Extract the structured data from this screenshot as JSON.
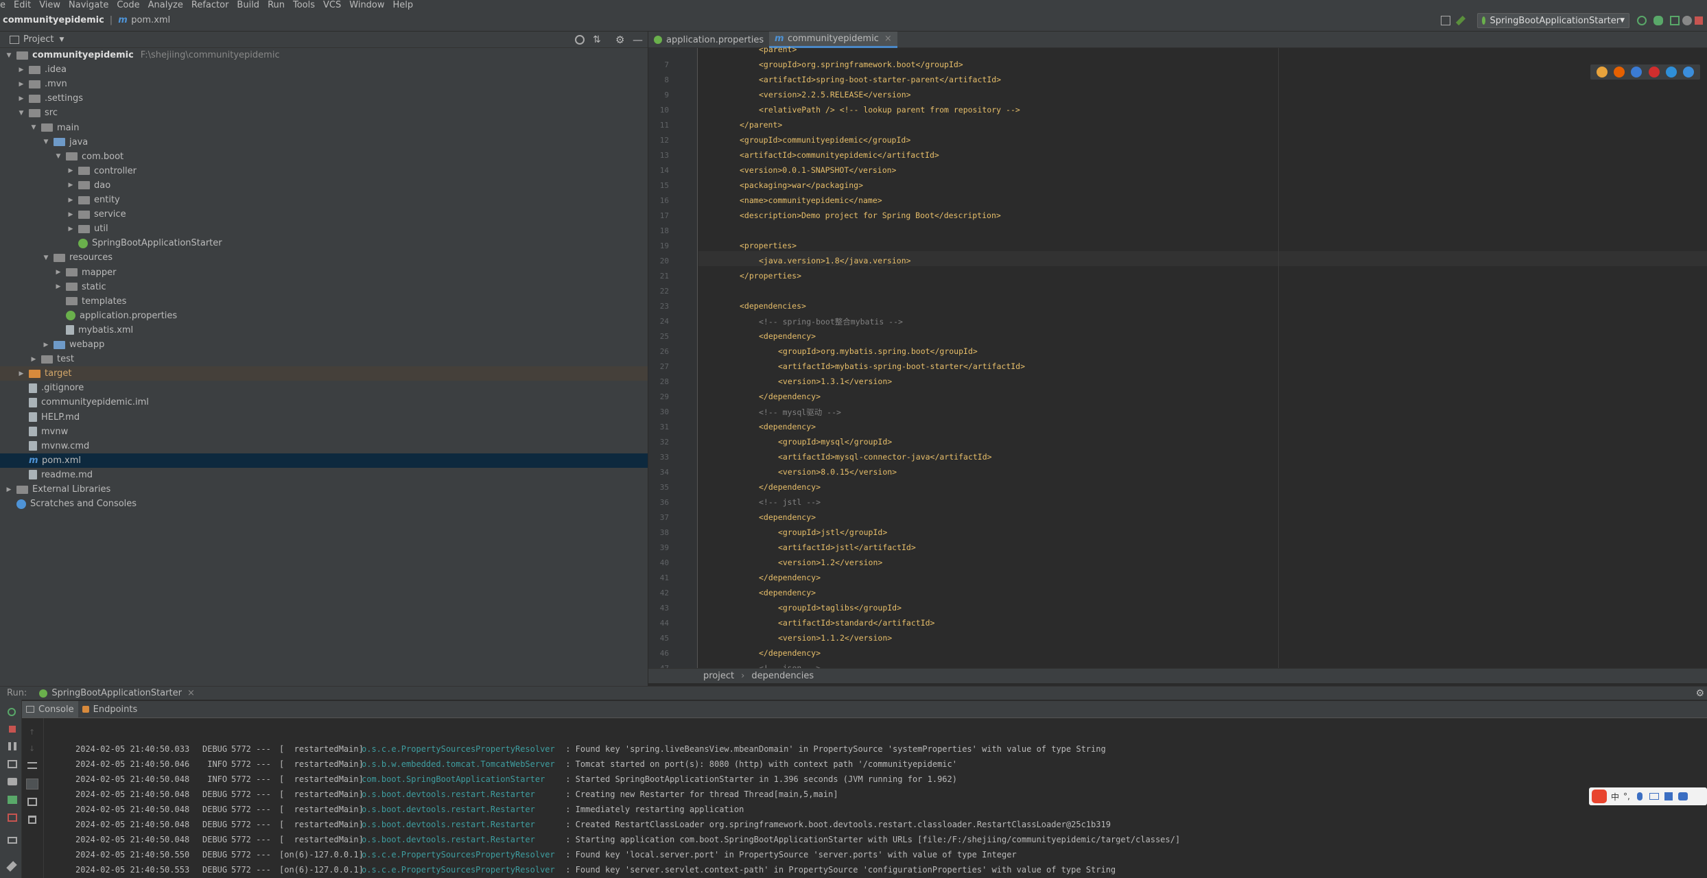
{
  "menu": [
    "e",
    "Edit",
    "View",
    "Navigate",
    "Code",
    "Analyze",
    "Refactor",
    "Build",
    "Run",
    "Tools",
    "VCS",
    "Window",
    "Help"
  ],
  "nav": {
    "project": "communityepidemic",
    "file": "pom.xml",
    "run_config": "SpringBootApplicationStarter"
  },
  "project_panel": {
    "title": "Project",
    "tree": [
      {
        "label": "communityepidemic",
        "path": "F:\\shejiing\\communityepidemic",
        "depth": 0,
        "icon": "folder-grey",
        "arrow": "▼",
        "bold": true
      },
      {
        "label": ".idea",
        "depth": 1,
        "icon": "folder-grey",
        "arrow": "▶"
      },
      {
        "label": ".mvn",
        "depth": 1,
        "icon": "folder-grey",
        "arrow": "▶"
      },
      {
        "label": ".settings",
        "depth": 1,
        "icon": "folder-grey",
        "arrow": "▶"
      },
      {
        "label": "src",
        "depth": 1,
        "icon": "folder-grey",
        "arrow": "▼"
      },
      {
        "label": "main",
        "depth": 2,
        "icon": "folder-grey",
        "arrow": "▼"
      },
      {
        "label": "java",
        "depth": 3,
        "icon": "folder-blue",
        "arrow": "▼"
      },
      {
        "label": "com.boot",
        "depth": 4,
        "icon": "folder-grey",
        "arrow": "▼"
      },
      {
        "label": "controller",
        "depth": 5,
        "icon": "folder-grey",
        "arrow": "▶"
      },
      {
        "label": "dao",
        "depth": 5,
        "icon": "folder-grey",
        "arrow": "▶"
      },
      {
        "label": "entity",
        "depth": 5,
        "icon": "folder-grey",
        "arrow": "▶"
      },
      {
        "label": "service",
        "depth": 5,
        "icon": "folder-grey",
        "arrow": "▶"
      },
      {
        "label": "util",
        "depth": 5,
        "icon": "folder-grey",
        "arrow": "▶"
      },
      {
        "label": "SpringBootApplicationStarter",
        "depth": 5,
        "icon": "spring",
        "arrow": ""
      },
      {
        "label": "resources",
        "depth": 3,
        "icon": "folder-grey",
        "arrow": "▼"
      },
      {
        "label": "mapper",
        "depth": 4,
        "icon": "folder-grey",
        "arrow": "▶"
      },
      {
        "label": "static",
        "depth": 4,
        "icon": "folder-grey",
        "arrow": "▶"
      },
      {
        "label": "templates",
        "depth": 4,
        "icon": "folder-grey",
        "arrow": ""
      },
      {
        "label": "application.properties",
        "depth": 4,
        "icon": "spring",
        "arrow": ""
      },
      {
        "label": "mybatis.xml",
        "depth": 4,
        "icon": "file",
        "arrow": ""
      },
      {
        "label": "webapp",
        "depth": 3,
        "icon": "folder-blue",
        "arrow": "▶"
      },
      {
        "label": "test",
        "depth": 2,
        "icon": "folder-grey",
        "arrow": "▶"
      },
      {
        "label": "target",
        "depth": 1,
        "icon": "folder-orange",
        "arrow": "▶",
        "state": "target"
      },
      {
        "label": ".gitignore",
        "depth": 1,
        "icon": "file",
        "arrow": ""
      },
      {
        "label": "communityepidemic.iml",
        "depth": 1,
        "icon": "file",
        "arrow": ""
      },
      {
        "label": "HELP.md",
        "depth": 1,
        "icon": "file",
        "arrow": ""
      },
      {
        "label": "mvnw",
        "depth": 1,
        "icon": "file",
        "arrow": ""
      },
      {
        "label": "mvnw.cmd",
        "depth": 1,
        "icon": "file",
        "arrow": ""
      },
      {
        "label": "pom.xml",
        "depth": 1,
        "icon": "maven",
        "arrow": "",
        "state": "selected"
      },
      {
        "label": "readme.md",
        "depth": 1,
        "icon": "file",
        "arrow": ""
      },
      {
        "label": "External Libraries",
        "depth": 0,
        "icon": "library",
        "arrow": "▶"
      },
      {
        "label": "Scratches and Consoles",
        "depth": 0,
        "icon": "scratch",
        "arrow": ""
      }
    ]
  },
  "editor": {
    "tabs": [
      "application.properties",
      "communityepidemic"
    ],
    "lines": [
      {
        "n": "",
        "indent": 2,
        "text": "<parent>"
      },
      {
        "n": "7",
        "indent": 2,
        "text": "<groupId>org.springframework.boot</groupId>"
      },
      {
        "n": "8",
        "indent": 2,
        "text": "<artifactId>spring-boot-starter-parent</artifactId>"
      },
      {
        "n": "9",
        "indent": 2,
        "text": "<version>2.2.5.RELEASE</version>"
      },
      {
        "n": "10",
        "indent": 2,
        "text": "<relativePath /> <!-- lookup parent from repository -->"
      },
      {
        "n": "11",
        "indent": 1,
        "text": "</parent>"
      },
      {
        "n": "12",
        "indent": 1,
        "text": "<groupId>communityepidemic</groupId>"
      },
      {
        "n": "13",
        "indent": 1,
        "text": "<artifactId>communityepidemic</artifactId>"
      },
      {
        "n": "14",
        "indent": 1,
        "text": "<version>0.0.1-SNAPSHOT</version>"
      },
      {
        "n": "15",
        "indent": 1,
        "text": "<packaging>war</packaging>"
      },
      {
        "n": "16",
        "indent": 1,
        "text": "<name>communityepidemic</name>"
      },
      {
        "n": "17",
        "indent": 1,
        "text": "<description>Demo project for Spring Boot</description>"
      },
      {
        "n": "18",
        "indent": 1,
        "text": ""
      },
      {
        "n": "19",
        "indent": 1,
        "text": "<properties>"
      },
      {
        "n": "20",
        "indent": 2,
        "text": "<java.version>1.8</java.version>"
      },
      {
        "n": "21",
        "indent": 1,
        "text": "</properties>"
      },
      {
        "n": "22",
        "indent": 1,
        "text": ""
      },
      {
        "n": "23",
        "indent": 1,
        "text": "<dependencies>"
      },
      {
        "n": "24",
        "indent": 2,
        "text": "<!-- spring-boot整合mybatis -->"
      },
      {
        "n": "25",
        "indent": 2,
        "text": "<dependency>"
      },
      {
        "n": "26",
        "indent": 3,
        "text": "<groupId>org.mybatis.spring.boot</groupId>"
      },
      {
        "n": "27",
        "indent": 3,
        "text": "<artifactId>mybatis-spring-boot-starter</artifactId>"
      },
      {
        "n": "28",
        "indent": 3,
        "text": "<version>1.3.1</version>"
      },
      {
        "n": "29",
        "indent": 2,
        "text": "</dependency>"
      },
      {
        "n": "30",
        "indent": 2,
        "text": "<!-- mysql驱动 -->"
      },
      {
        "n": "31",
        "indent": 2,
        "text": "<dependency>"
      },
      {
        "n": "32",
        "indent": 3,
        "text": "<groupId>mysql</groupId>"
      },
      {
        "n": "33",
        "indent": 3,
        "text": "<artifactId>mysql-connector-java</artifactId>"
      },
      {
        "n": "34",
        "indent": 3,
        "text": "<version>8.0.15</version>"
      },
      {
        "n": "35",
        "indent": 2,
        "text": "</dependency>"
      },
      {
        "n": "36",
        "indent": 2,
        "text": "<!-- jstl -->"
      },
      {
        "n": "37",
        "indent": 2,
        "text": "<dependency>"
      },
      {
        "n": "38",
        "indent": 3,
        "text": "<groupId>jstl</groupId>"
      },
      {
        "n": "39",
        "indent": 3,
        "text": "<artifactId>jstl</artifactId>"
      },
      {
        "n": "40",
        "indent": 3,
        "text": "<version>1.2</version>"
      },
      {
        "n": "41",
        "indent": 2,
        "text": "</dependency>"
      },
      {
        "n": "42",
        "indent": 2,
        "text": "<dependency>"
      },
      {
        "n": "43",
        "indent": 3,
        "text": "<groupId>taglibs</groupId>"
      },
      {
        "n": "44",
        "indent": 3,
        "text": "<artifactId>standard</artifactId>"
      },
      {
        "n": "45",
        "indent": 3,
        "text": "<version>1.1.2</version>"
      },
      {
        "n": "46",
        "indent": 2,
        "text": "</dependency>"
      },
      {
        "n": "47",
        "indent": 2,
        "text": "<!-- json -->"
      }
    ],
    "breadcrumb": [
      "project",
      "dependencies"
    ]
  },
  "run_panel": {
    "label": "Run:",
    "config": "SpringBootApplicationStarter",
    "tabs": [
      "Console",
      "Endpoints"
    ],
    "log": [
      {
        "ts": "2024-02-05 21:40:50.033",
        "lvl": "DEBUG",
        "pid": "5772",
        "thread": "[  restartedMain]",
        "cls": "o.s.c.e.PropertySourcesPropertyResolver",
        "msg": ": Found key 'spring.liveBeansView.mbeanDomain' in PropertySource 'systemProperties' with value of type String"
      },
      {
        "ts": "2024-02-05 21:40:50.046",
        "lvl": " INFO",
        "pid": "5772",
        "thread": "[  restartedMain]",
        "cls": "o.s.b.w.embedded.tomcat.TomcatWebServer",
        "msg": ": Tomcat started on port(s): 8080 (http) with context path '/communityepidemic'"
      },
      {
        "ts": "2024-02-05 21:40:50.048",
        "lvl": " INFO",
        "pid": "5772",
        "thread": "[  restartedMain]",
        "cls": "com.boot.SpringBootApplicationStarter",
        "msg": ": Started SpringBootApplicationStarter in 1.396 seconds (JVM running for 1.962)"
      },
      {
        "ts": "2024-02-05 21:40:50.048",
        "lvl": "DEBUG",
        "pid": "5772",
        "thread": "[  restartedMain]",
        "cls": "o.s.boot.devtools.restart.Restarter",
        "msg": ": Creating new Restarter for thread Thread[main,5,main]"
      },
      {
        "ts": "2024-02-05 21:40:50.048",
        "lvl": "DEBUG",
        "pid": "5772",
        "thread": "[  restartedMain]",
        "cls": "o.s.boot.devtools.restart.Restarter",
        "msg": ": Immediately restarting application"
      },
      {
        "ts": "2024-02-05 21:40:50.048",
        "lvl": "DEBUG",
        "pid": "5772",
        "thread": "[  restartedMain]",
        "cls": "o.s.boot.devtools.restart.Restarter",
        "msg": ": Created RestartClassLoader org.springframework.boot.devtools.restart.classloader.RestartClassLoader@25c1b319"
      },
      {
        "ts": "2024-02-05 21:40:50.048",
        "lvl": "DEBUG",
        "pid": "5772",
        "thread": "[  restartedMain]",
        "cls": "o.s.boot.devtools.restart.Restarter",
        "msg": ": Starting application com.boot.SpringBootApplicationStarter with URLs [file:/F:/shejiing/communityepidemic/target/classes/]"
      },
      {
        "ts": "2024-02-05 21:40:50.550",
        "lvl": "DEBUG",
        "pid": "5772",
        "thread": "[on(6)-127.0.0.1]",
        "cls": "o.s.c.e.PropertySourcesPropertyResolver",
        "msg": ": Found key 'local.server.port' in PropertySource 'server.ports' with value of type Integer"
      },
      {
        "ts": "2024-02-05 21:40:50.553",
        "lvl": "DEBUG",
        "pid": "5772",
        "thread": "[on(6)-127.0.0.1]",
        "cls": "o.s.c.e.PropertySourcesPropertyResolver",
        "msg": ": Found key 'server.servlet.context-path' in PropertySource 'configurationProperties' with value of type String"
      }
    ]
  },
  "ime": {
    "label": "中"
  }
}
